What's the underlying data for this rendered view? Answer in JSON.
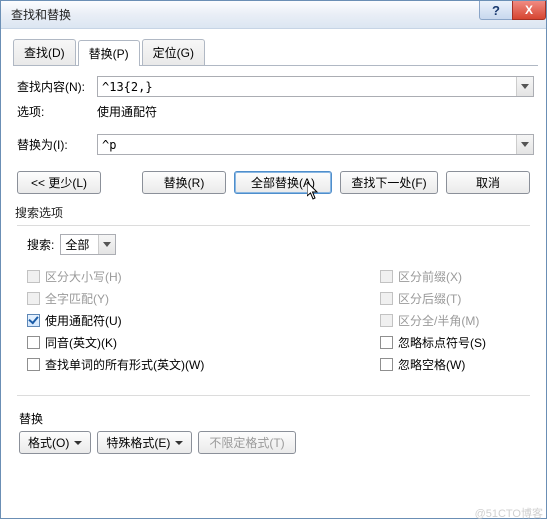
{
  "window": {
    "title": "查找和替换"
  },
  "tabs": {
    "find": "查找(D)",
    "replace": "替换(P)",
    "goto": "定位(G)"
  },
  "form": {
    "find_label": "查找内容(N):",
    "find_value": "^13{2,}",
    "options_label": "选项:",
    "options_value": "使用通配符",
    "replace_label": "替换为(I):",
    "replace_value": "^p"
  },
  "buttons": {
    "less": "<<  更少(L)",
    "replace": "替换(R)",
    "replace_all": "全部替换(A)",
    "find_next": "查找下一处(F)",
    "cancel": "取消"
  },
  "search_options": {
    "section_label": "搜索选项",
    "search_label": "搜索:",
    "search_value": "全部",
    "left": [
      {
        "label": "区分大小写(H)",
        "checked": false,
        "enabled": false
      },
      {
        "label": "全字匹配(Y)",
        "checked": false,
        "enabled": false
      },
      {
        "label": "使用通配符(U)",
        "checked": true,
        "enabled": true
      },
      {
        "label": "同音(英文)(K)",
        "checked": false,
        "enabled": true
      },
      {
        "label": "查找单词的所有形式(英文)(W)",
        "checked": false,
        "enabled": true
      }
    ],
    "right": [
      {
        "label": "区分前缀(X)",
        "checked": false,
        "enabled": false
      },
      {
        "label": "区分后缀(T)",
        "checked": false,
        "enabled": false
      },
      {
        "label": "区分全/半角(M)",
        "checked": false,
        "enabled": false
      },
      {
        "label": "忽略标点符号(S)",
        "checked": false,
        "enabled": true
      },
      {
        "label": "忽略空格(W)",
        "checked": false,
        "enabled": true
      }
    ]
  },
  "replace_section": {
    "label": "替换",
    "format": "格式(O)",
    "special": "特殊格式(E)",
    "no_format": "不限定格式(T)"
  },
  "watermark": "@51CTO博客"
}
